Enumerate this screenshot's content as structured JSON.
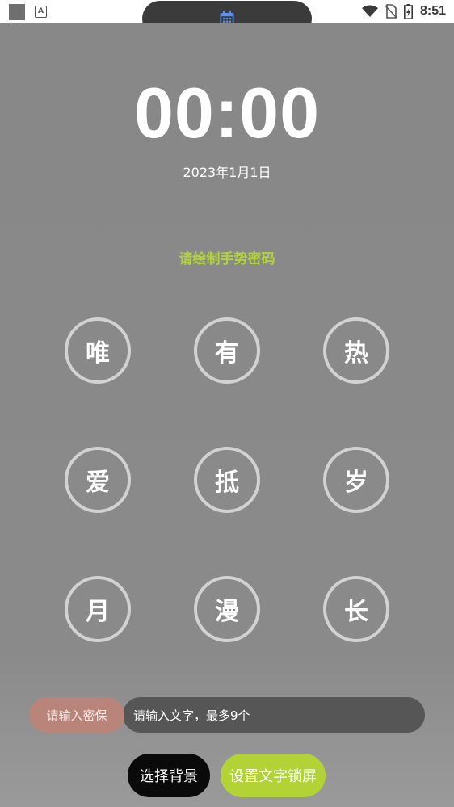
{
  "status_bar": {
    "time": "8:51",
    "icons": [
      "app-square-icon",
      "a-letter-icon",
      "wifi-icon",
      "no-sim-icon",
      "battery-charging-icon"
    ],
    "a_letter": "A"
  },
  "pill": {
    "icon": "calendar-icon",
    "accent": "#5b8ff0"
  },
  "lock": {
    "clock": "00:00",
    "date": "2023年1月1日",
    "hint": "请绘制手势密码",
    "grid": [
      "唯",
      "有",
      "热",
      "爱",
      "抵",
      "岁",
      "月",
      "漫",
      "长"
    ]
  },
  "form": {
    "password_placeholder": "请输入密保",
    "text_placeholder": "请输入文字，最多9个"
  },
  "buttons": {
    "choose_background": "选择背景",
    "set_text_lock": "设置文字锁屏"
  },
  "colors": {
    "hint": "#b3d23a",
    "primary_button": "#b2d235",
    "password_field": "#b9847a"
  }
}
